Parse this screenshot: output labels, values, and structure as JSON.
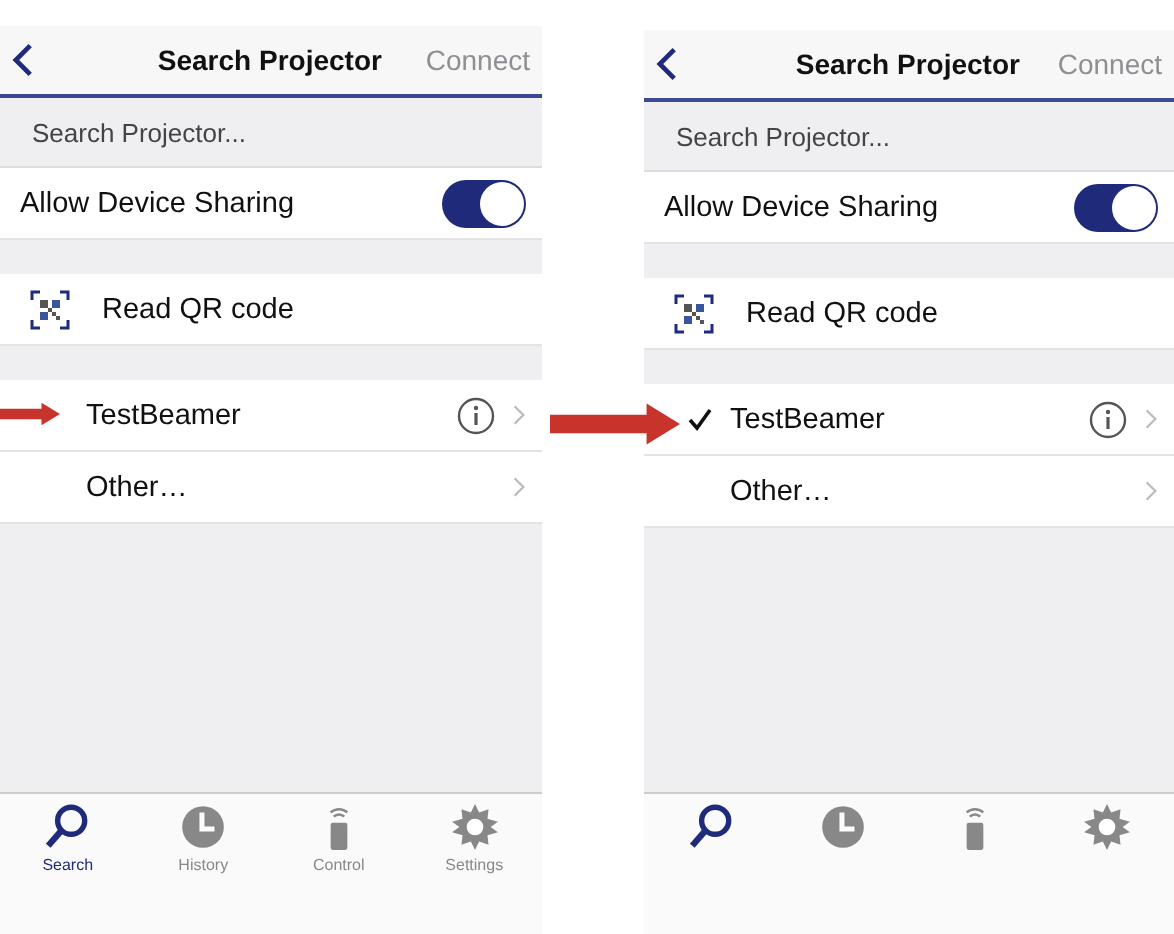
{
  "screens": [
    {
      "nav": {
        "title": "Search Projector",
        "action": "Connect"
      },
      "section_label": "Search Projector...",
      "sharing": {
        "label": "Allow Device Sharing",
        "on": true
      },
      "qr": {
        "label": "Read QR code"
      },
      "devices": [
        {
          "name": "TestBeamer",
          "checked": false,
          "info": true
        },
        {
          "name": "Other…",
          "checked": false,
          "info": false
        }
      ],
      "tabs": [
        {
          "kind": "search",
          "label": "Search",
          "selected": true
        },
        {
          "kind": "history",
          "label": "History",
          "selected": false
        },
        {
          "kind": "control",
          "label": "Control",
          "selected": false
        },
        {
          "kind": "settings",
          "label": "Settings",
          "selected": false
        }
      ]
    },
    {
      "nav": {
        "title": "Search Projector",
        "action": "Connect"
      },
      "section_label": "Search Projector...",
      "sharing": {
        "label": "Allow Device Sharing",
        "on": true
      },
      "qr": {
        "label": "Read QR code"
      },
      "devices": [
        {
          "name": "TestBeamer",
          "checked": true,
          "info": true
        },
        {
          "name": "Other…",
          "checked": false,
          "info": false
        }
      ],
      "tabs": [
        {
          "kind": "search",
          "selected": true
        },
        {
          "kind": "history",
          "selected": false
        },
        {
          "kind": "control",
          "selected": false
        },
        {
          "kind": "settings",
          "selected": false
        }
      ]
    }
  ]
}
